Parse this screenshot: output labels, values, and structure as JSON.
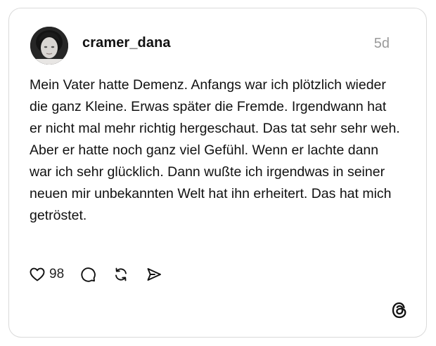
{
  "post": {
    "username": "cramer_dana",
    "timestamp": "5d",
    "text": "Mein Vater hatte Demenz. Anfangs war ich plötzlich wieder die ganz Kleine. Erwas später die Fremde. Irgendwann hat er nicht mal mehr richtig hergeschaut. Das tat sehr sehr weh. Aber er hatte noch ganz viel Gefühl. Wenn er lachte dann war ich sehr glücklich. Dann wußte ich irgendwas in seiner neuen mir unbekannten Welt hat ihn erheitert. Das hat mich getröstet.",
    "likes": "98"
  },
  "icons": {
    "like": "heart-outline-icon",
    "reply": "speech-bubble-icon",
    "repost": "repost-arrows-icon",
    "share": "send-arrow-icon",
    "brand": "threads-logo-icon"
  },
  "colors": {
    "text": "#111111",
    "muted": "#9a9a9a",
    "border": "#dadada",
    "background": "#ffffff"
  }
}
